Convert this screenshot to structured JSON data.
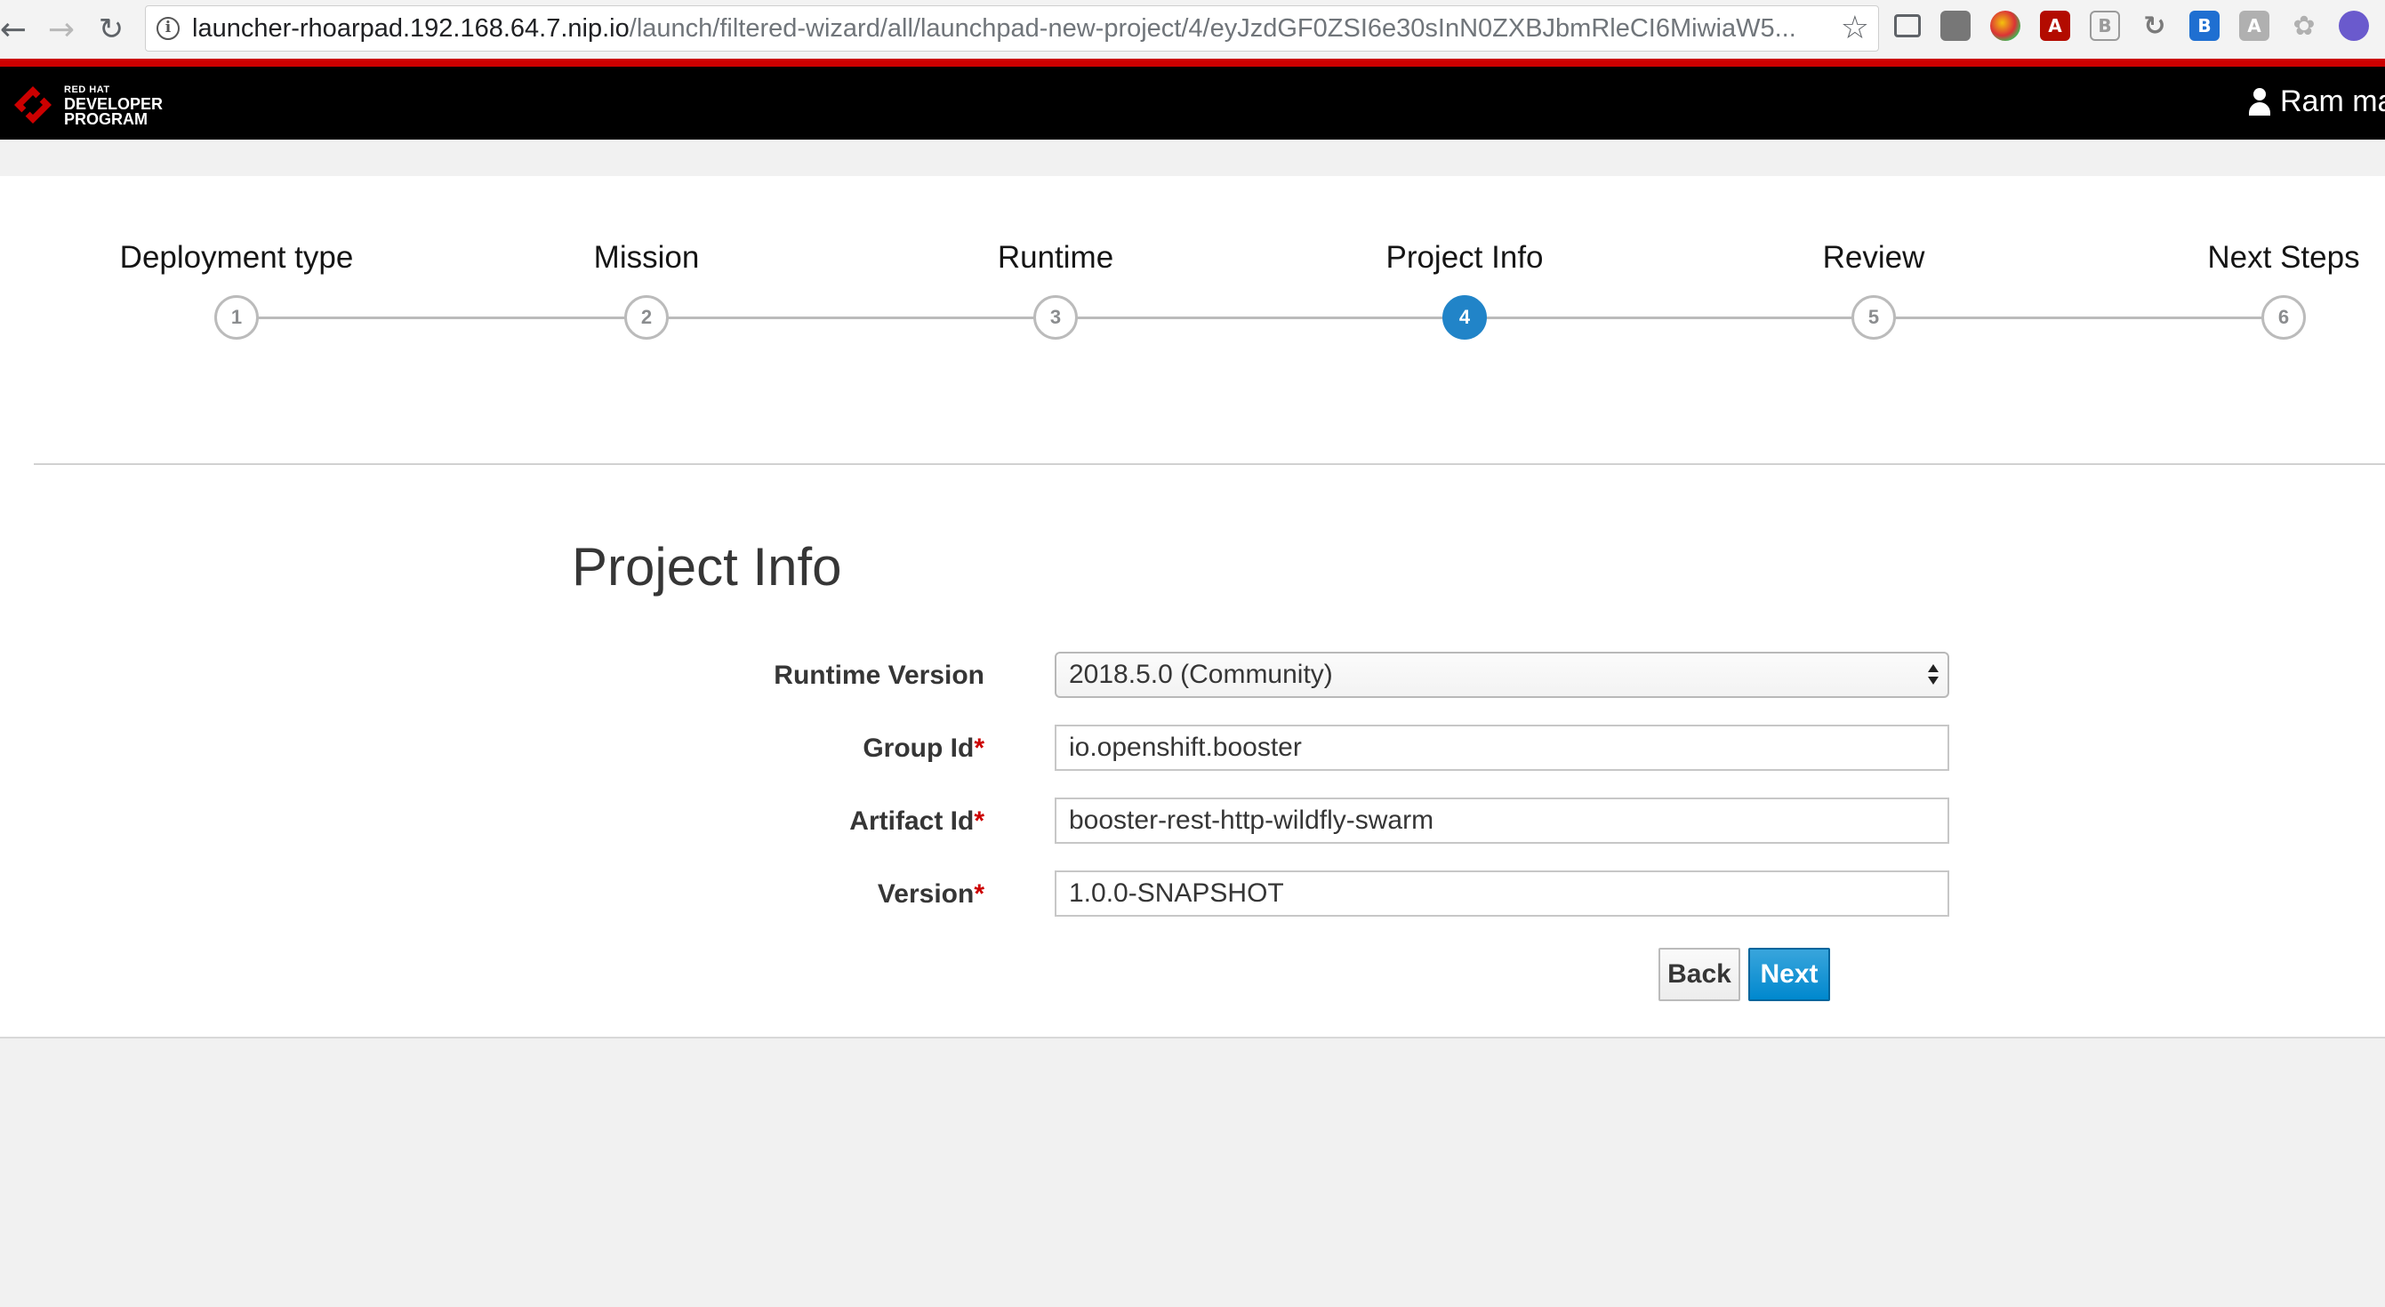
{
  "browser": {
    "url_host": "launcher-rhoarpad.192.168.64.7.nip.io",
    "url_path": "/launch/filtered-wizard/all/launchpad-new-project/4/eyJzdGF0ZSI6e30sInN0ZXBJbmRleCI6MiwiaW5..."
  },
  "header": {
    "logo_line1": "RED HAT",
    "logo_line2": "DEVELOPER",
    "logo_line3": "PROGRAM",
    "user_name": "Ram ma",
    "brand_color": "#cc0000"
  },
  "wizard": {
    "steps": [
      {
        "label": "Deployment type",
        "number": "1",
        "state": "inactive"
      },
      {
        "label": "Mission",
        "number": "2",
        "state": "inactive"
      },
      {
        "label": "Runtime",
        "number": "3",
        "state": "inactive"
      },
      {
        "label": "Project Info",
        "number": "4",
        "state": "active"
      },
      {
        "label": "Review",
        "number": "5",
        "state": "inactive"
      },
      {
        "label": "Next Steps",
        "number": "6",
        "state": "inactive"
      }
    ],
    "active_color": "#2184c8"
  },
  "form": {
    "title": "Project Info",
    "runtime_version": {
      "label": "Runtime Version",
      "value": "2018.5.0 (Community)"
    },
    "group_id": {
      "label": "Group Id",
      "required_mark": "*",
      "value": "io.openshift.booster"
    },
    "artifact_id": {
      "label": "Artifact Id",
      "required_mark": "*",
      "value": "booster-rest-http-wildfly-swarm"
    },
    "version": {
      "label": "Version",
      "required_mark": "*",
      "value": "1.0.0-SNAPSHOT"
    },
    "back_label": "Back",
    "next_label": "Next"
  }
}
